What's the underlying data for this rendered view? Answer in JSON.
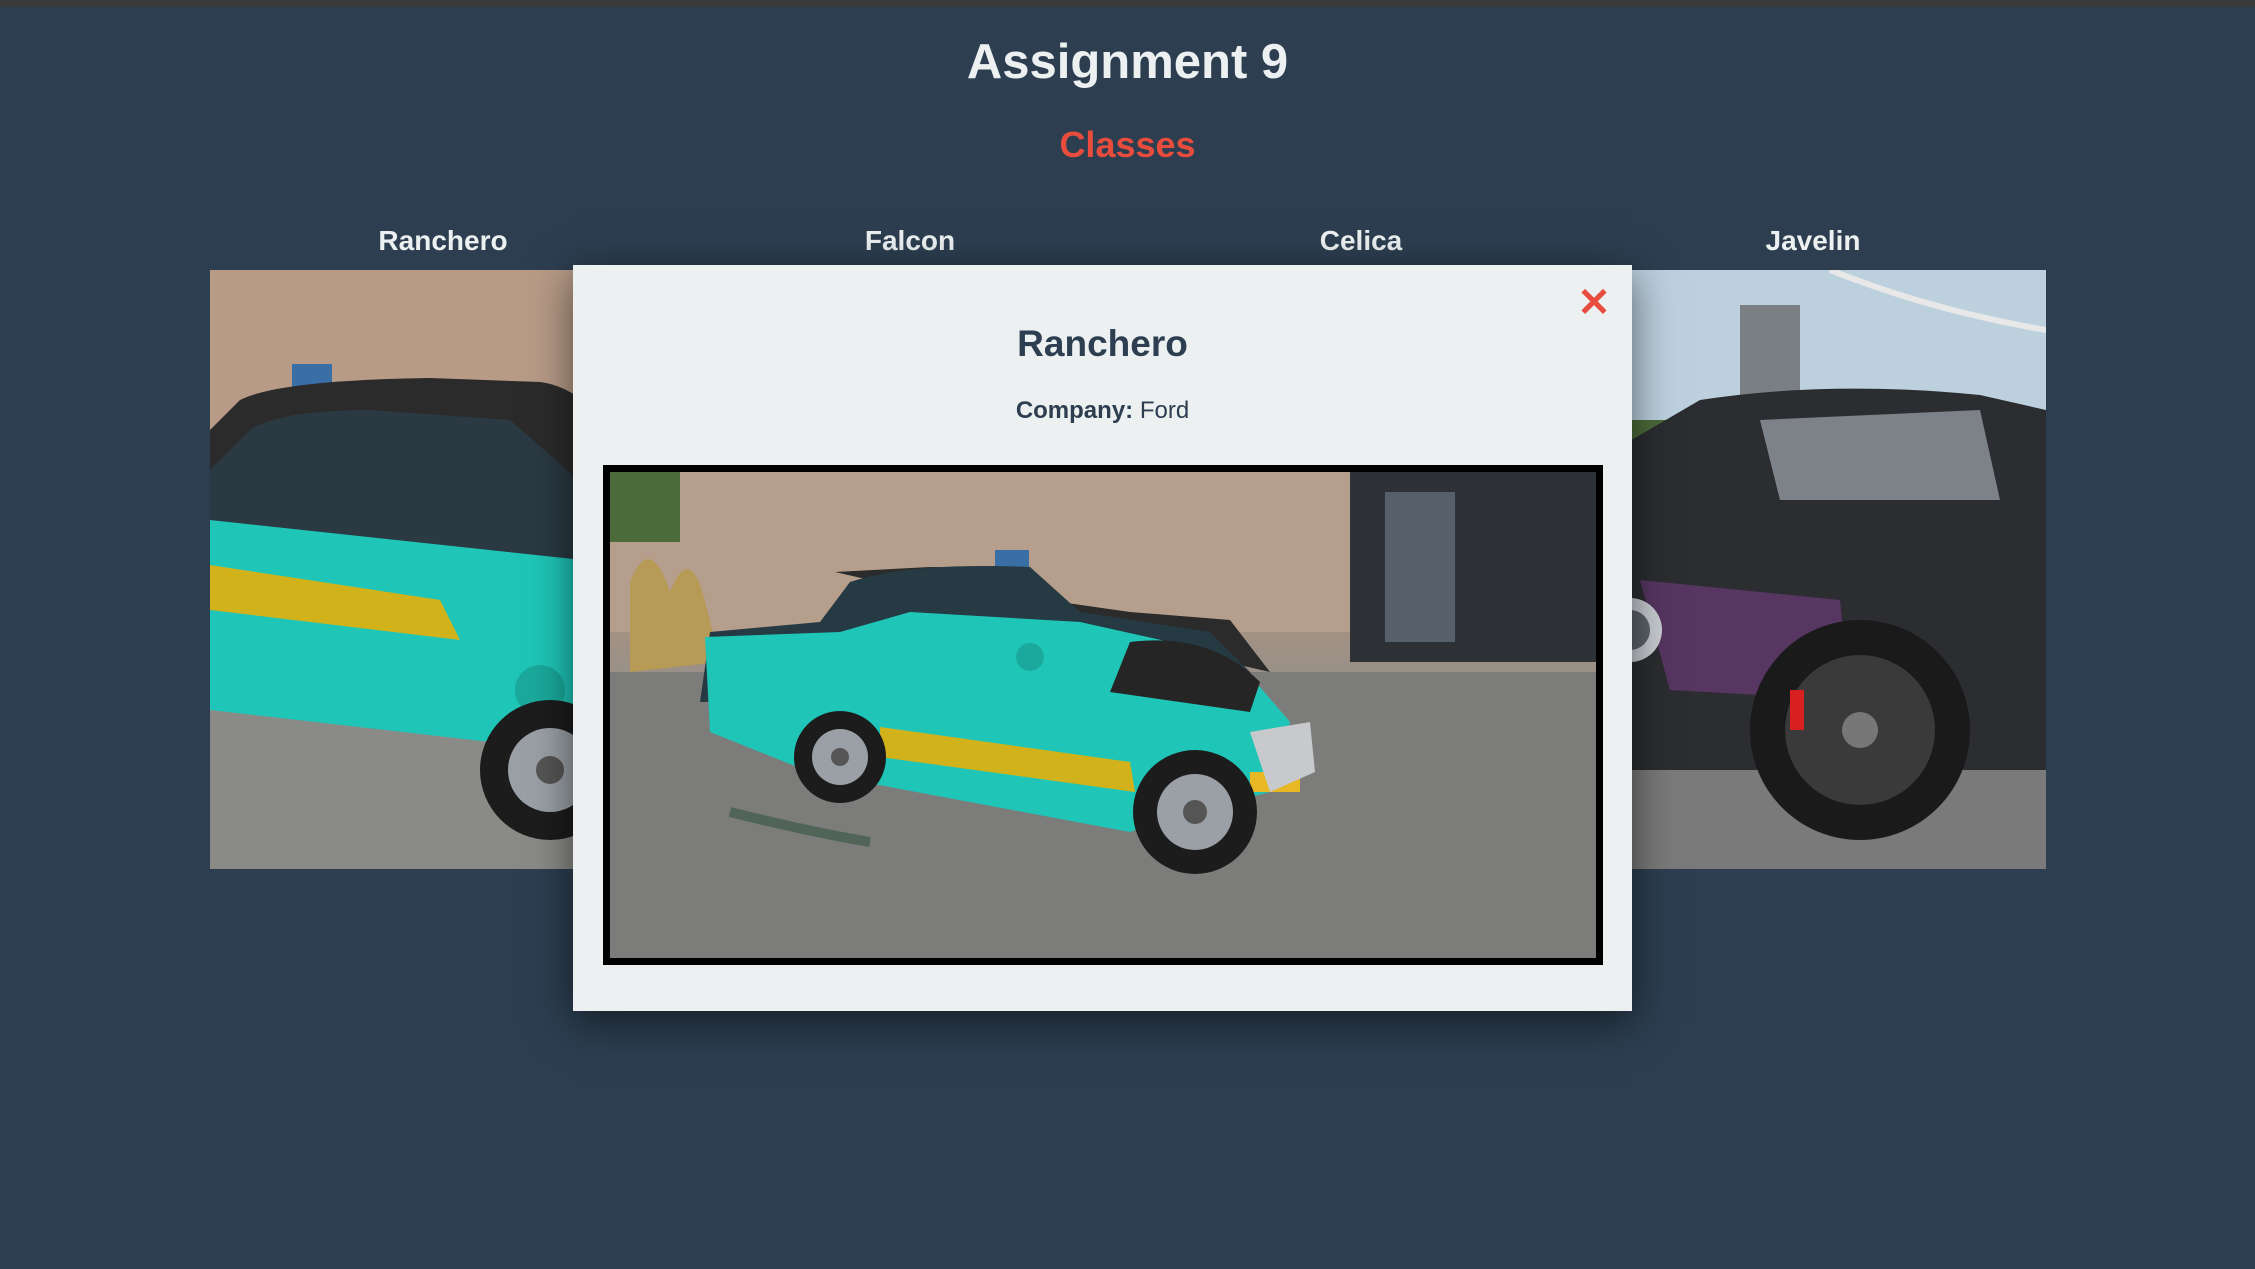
{
  "page": {
    "title": "Assignment 9",
    "subtitle": "Classes"
  },
  "cars": [
    {
      "name": "Ranchero"
    },
    {
      "name": "Falcon"
    },
    {
      "name": "Celica"
    },
    {
      "name": "Javelin"
    }
  ],
  "modal": {
    "close_icon": "close-icon",
    "close_symbol": "✕",
    "title": "Ranchero",
    "company_label": "Company:",
    "company_value": "Ford"
  },
  "colors": {
    "background": "#2c3e50",
    "accent": "#e74c3c",
    "text_light": "#ecf0f1",
    "modal_bg": "#ecf0f1",
    "text_dark": "#2c3e50",
    "car_body": "#1fc6b8",
    "car_stripe": "#d2b21a"
  }
}
